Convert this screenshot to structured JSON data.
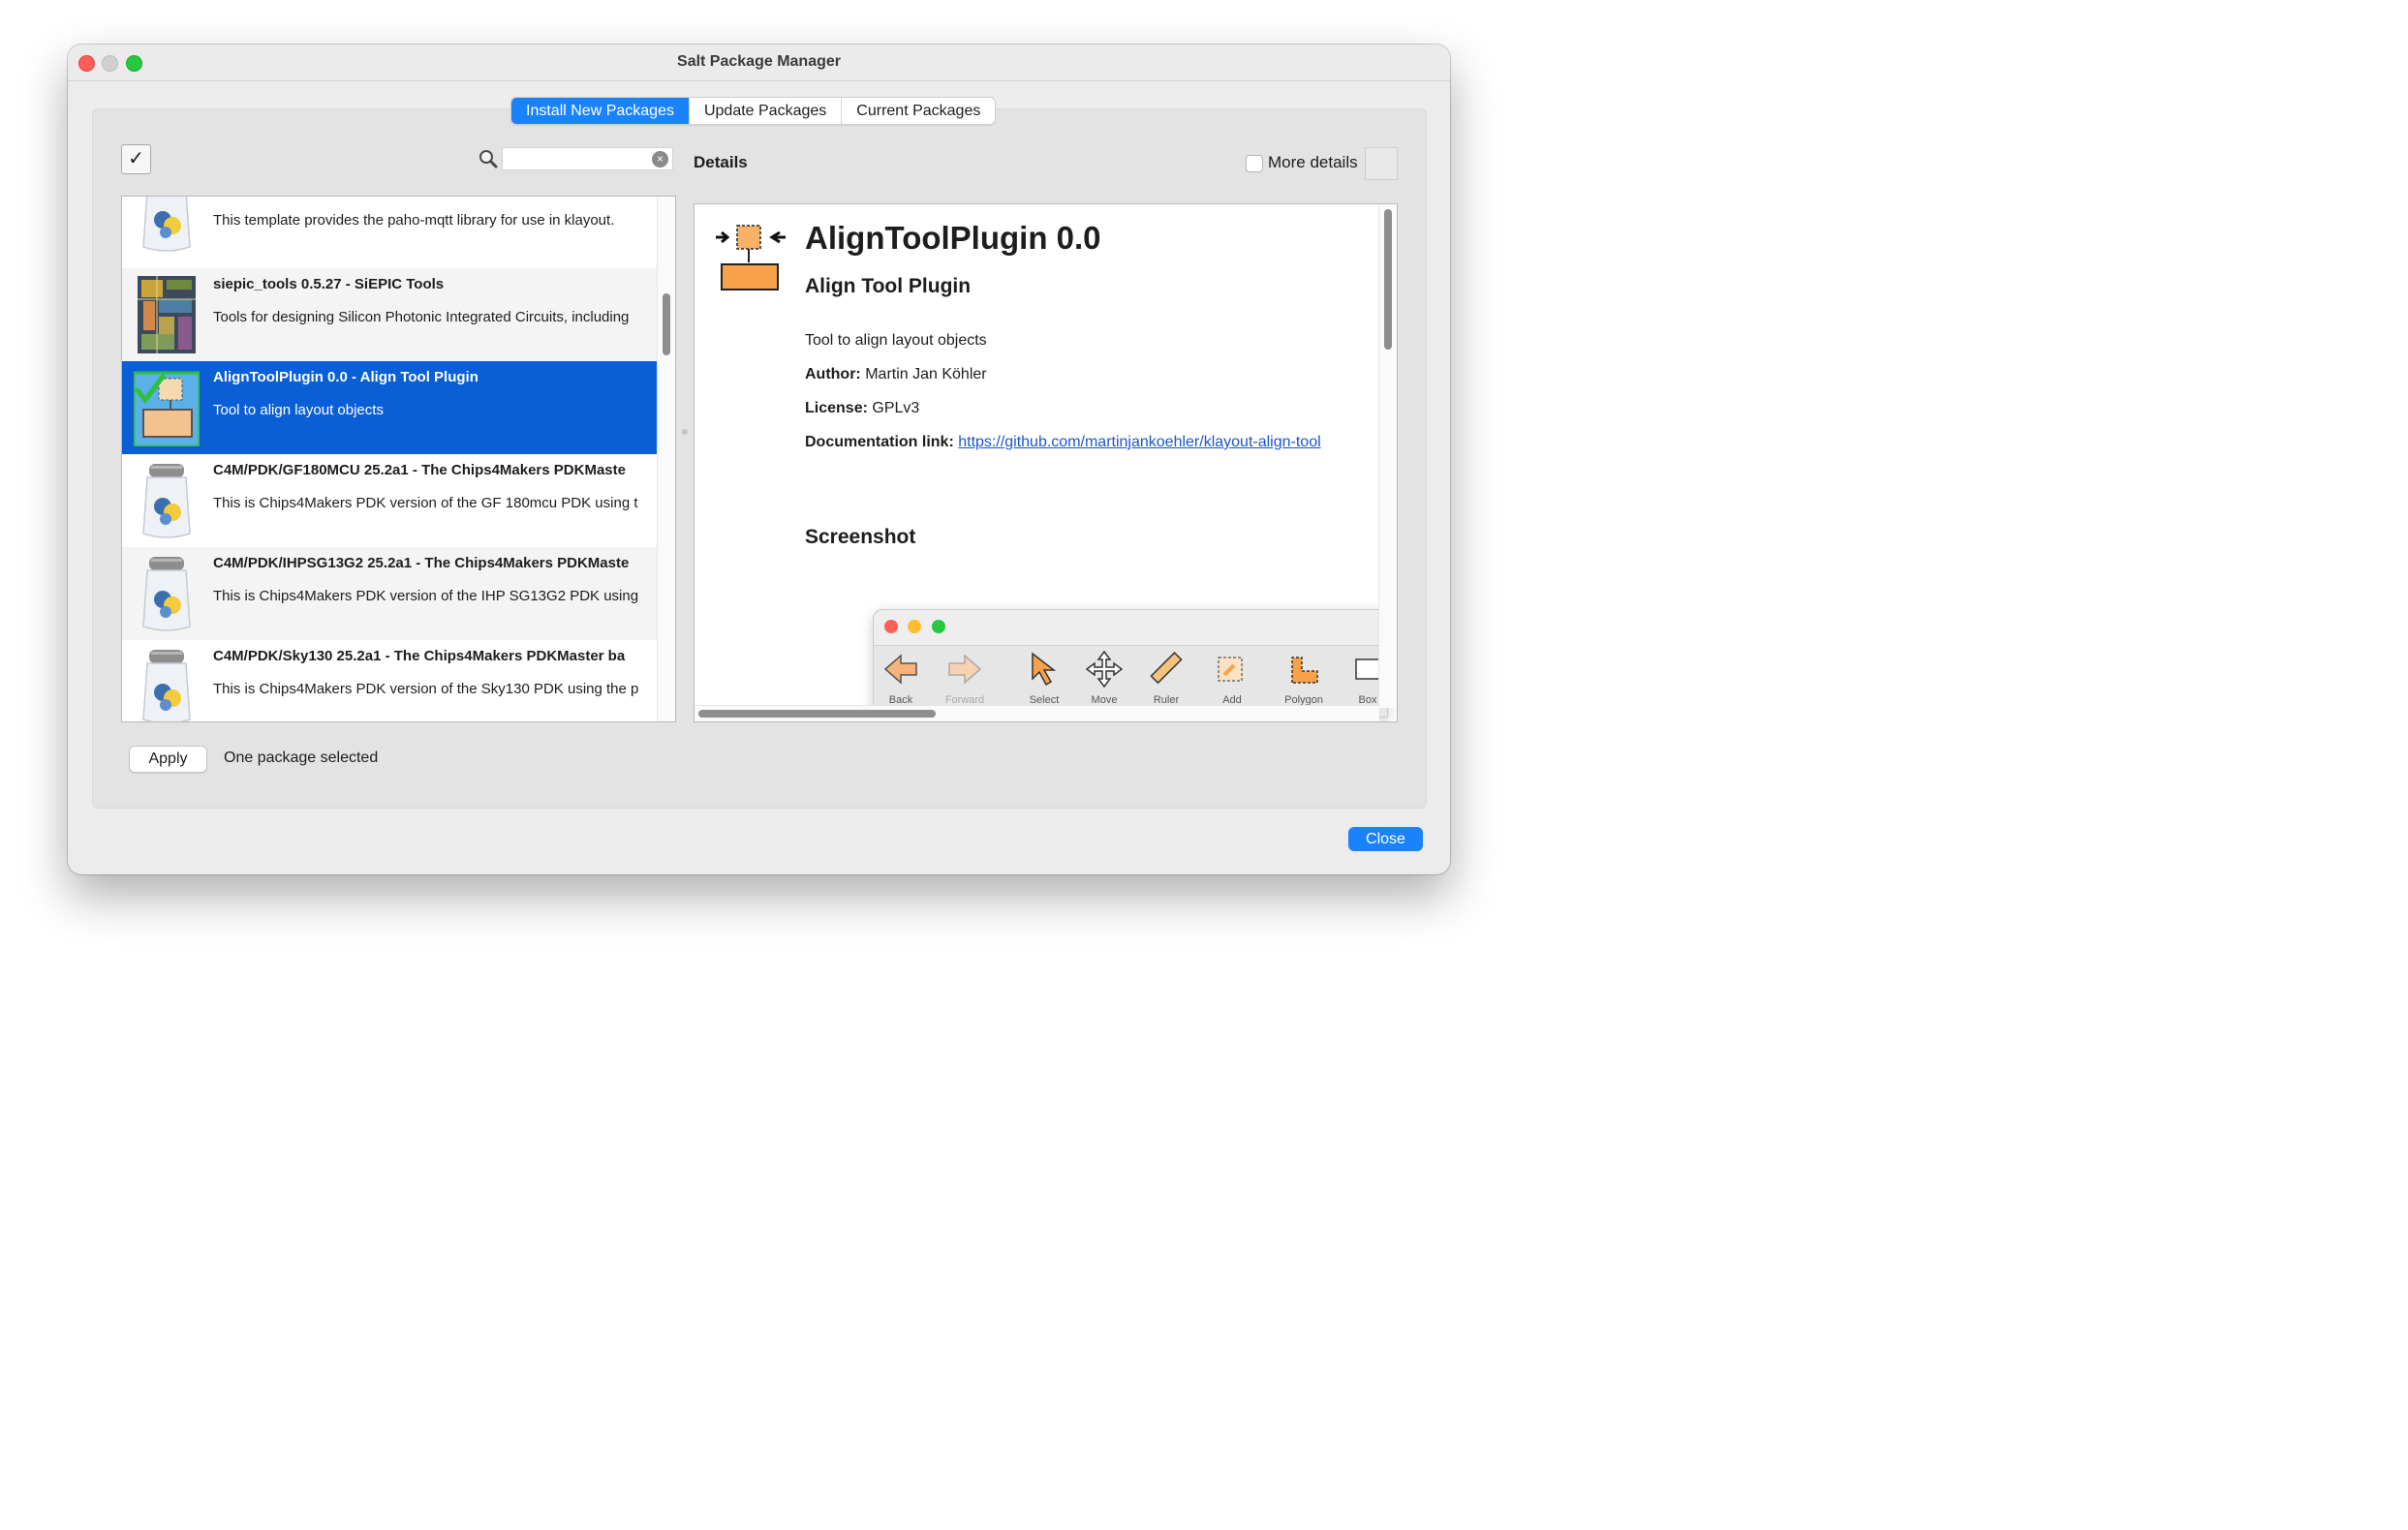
{
  "window": {
    "title": "Salt Package Manager"
  },
  "tabs": [
    {
      "label": "Install New Packages",
      "active": true
    },
    {
      "label": "Update Packages",
      "active": false
    },
    {
      "label": "Current Packages",
      "active": false
    }
  ],
  "search": {
    "value": "",
    "placeholder": ""
  },
  "select_all": {
    "checked": true,
    "mark": "✓"
  },
  "packages": [
    {
      "name": "",
      "description": "This template provides the paho-mqtt library for use in klayout.",
      "icon": "salt-shaker-icon"
    },
    {
      "name": "siepic_tools 0.5.27 - SiEPIC Tools",
      "description": "Tools for designing Silicon Photonic Integrated Circuits, including",
      "icon": "chip-layout-icon"
    },
    {
      "name": "AlignToolPlugin 0.0 - Align Tool Plugin",
      "description": "Tool to align layout objects",
      "icon": "align-tool-icon",
      "selected": true
    },
    {
      "name": "C4M/PDK/GF180MCU 25.2a1 - The Chips4Makers PDKMaste",
      "description": "This is Chips4Makers PDK version of the GF 180mcu PDK using t",
      "icon": "salt-shaker-icon"
    },
    {
      "name": "C4M/PDK/IHPSG13G2 25.2a1 - The Chips4Makers PDKMaste",
      "description": "This is Chips4Makers PDK version of the IHP SG13G2 PDK using",
      "icon": "salt-shaker-icon"
    },
    {
      "name": "C4M/PDK/Sky130 25.2a1 - The Chips4Makers PDKMaster ba",
      "description": "This is Chips4Makers PDK version of the Sky130 PDK using the p",
      "icon": "salt-shaker-icon"
    }
  ],
  "details": {
    "label": "Details",
    "more_details_label": "More details",
    "more_details_checked": false,
    "title": "AlignToolPlugin 0.0",
    "subtitle": "Align Tool Plugin",
    "description": "Tool to align layout objects",
    "author_label": "Author:",
    "author": "Martin Jan Köhler",
    "license_label": "License:",
    "license": "GPLv3",
    "doc_label": "Documentation link:",
    "doc_link": "https://github.com/martinjankoehler/klayout-align-tool",
    "screenshot_heading": "Screenshot",
    "screenshot_tools": [
      "Back",
      "Forward",
      "Select",
      "Move",
      "Ruler",
      "Add",
      "Polygon",
      "Box"
    ]
  },
  "footer": {
    "apply_label": "Apply",
    "status": "One package selected",
    "close_label": "Close"
  },
  "colors": {
    "accent": "#1a82fb",
    "selection": "#0a5fd6",
    "link": "#1a55cc",
    "traffic_close": "#ff5f57",
    "traffic_zoom": "#28c840"
  }
}
